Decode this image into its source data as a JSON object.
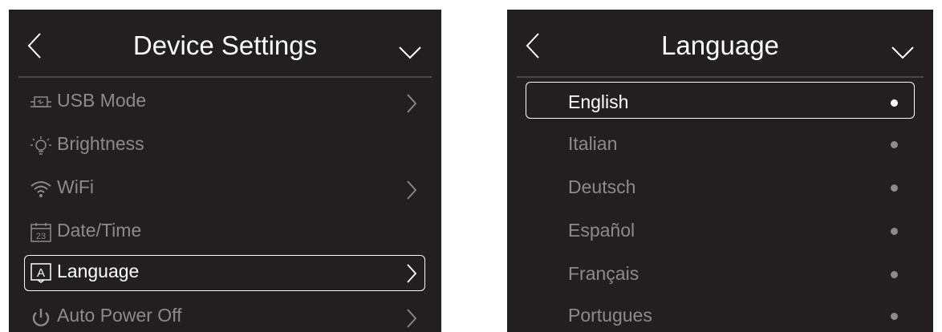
{
  "device_settings": {
    "title": "Device Settings",
    "items": [
      {
        "label": "USB Mode",
        "icon": "usb-icon",
        "has_arrow": true
      },
      {
        "label": "Brightness",
        "icon": "bulb-icon",
        "has_arrow": false
      },
      {
        "label": "WiFi",
        "icon": "wifi-icon",
        "has_arrow": true
      },
      {
        "label": "Date/Time",
        "icon": "calendar-icon",
        "has_arrow": false
      },
      {
        "label": "Language",
        "icon": "language-icon",
        "has_arrow": true,
        "selected": true
      },
      {
        "label": "Auto Power Off",
        "icon": "power-icon",
        "has_arrow": true
      }
    ],
    "calendar_day": "23",
    "language_icon_letter": "A"
  },
  "language": {
    "title": "Language",
    "options": [
      {
        "label": "English",
        "selected": true
      },
      {
        "label": "Italian"
      },
      {
        "label": "Deutsch"
      },
      {
        "label": "Español"
      },
      {
        "label": "Français"
      },
      {
        "label": "Portugues"
      }
    ]
  },
  "colors": {
    "panel_bg": "#231f20",
    "active_text": "#ffffff",
    "inactive_text": "#8e8a8b",
    "divider": "#4c4748"
  }
}
